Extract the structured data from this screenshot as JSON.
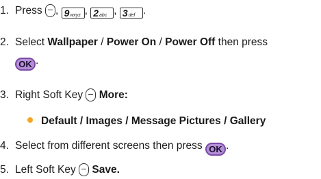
{
  "steps": [
    {
      "number": "1.",
      "text_pre": "Press",
      "keys": [
        {
          "glyph": "9",
          "letters": "wxyz"
        },
        {
          "glyph": "2",
          "letters": "abc"
        },
        {
          "glyph": "3",
          "letters": "def"
        }
      ]
    },
    {
      "number": "2.",
      "text_pre": "Select",
      "items": [
        "Wallpaper",
        "Power On",
        "Power Off"
      ],
      "text_post": "then press",
      "ok_label": "OK"
    },
    {
      "number": "3.",
      "text_pre": "Right Soft Key",
      "bold": "More:"
    },
    {
      "number": "4.",
      "text_pre": "Select from different screens then press",
      "ok_label": "OK"
    },
    {
      "number": "5.",
      "text_pre": "Left Soft Key",
      "bold": "Save."
    }
  ],
  "bullet": {
    "items": [
      "Default",
      "Images",
      "Message Pictures",
      "Gallery"
    ],
    "color": "#f5a623"
  },
  "separator": "/",
  "accent_ok_fill": "#b48fd6"
}
